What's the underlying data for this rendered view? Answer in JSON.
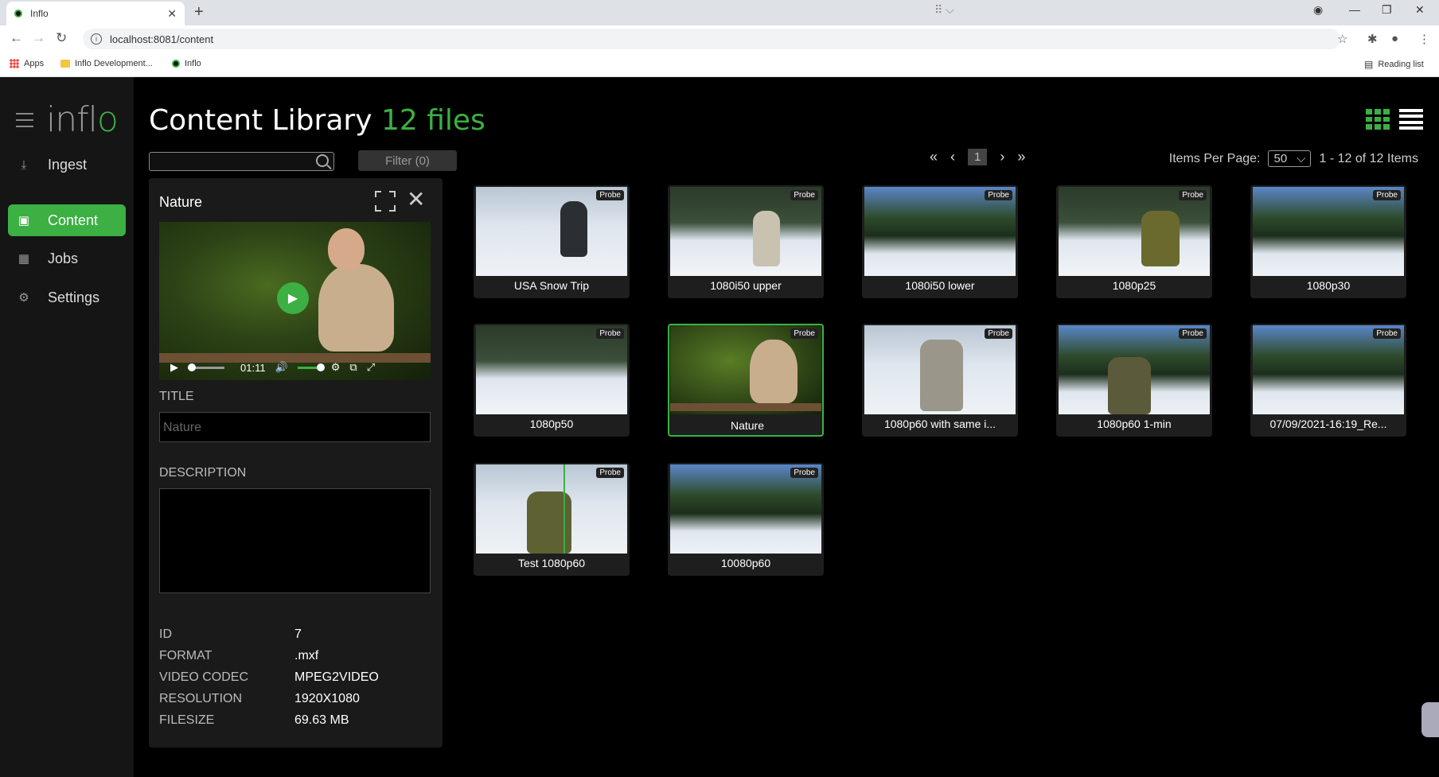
{
  "browser": {
    "tab_title": "Inflo",
    "url": "localhost:8081/content",
    "bookmarks": [
      "Apps",
      "Inflo Development...",
      "Inflo"
    ],
    "reading_list": "Reading list"
  },
  "sidebar": {
    "logo_prefix": "infl",
    "logo_suffix": "o",
    "items": [
      {
        "label": "Ingest",
        "icon": "download-icon"
      },
      {
        "label": "Content",
        "icon": "video-icon"
      },
      {
        "label": "Jobs",
        "icon": "board-icon"
      },
      {
        "label": "Settings",
        "icon": "gear-icon"
      }
    ]
  },
  "header": {
    "title": "Content Library",
    "count": "12 files"
  },
  "toolbar": {
    "search_placeholder": "",
    "filter_label": "Filter (0)",
    "page": "1",
    "items_per_page_label": "Items Per Page:",
    "items_per_page_value": "50",
    "range_text": "1 - 12 of 12 Items"
  },
  "detail": {
    "title": "Nature",
    "player_time": "01:11",
    "title_label": "TITLE",
    "title_value": "Nature",
    "description_label": "DESCRIPTION",
    "description_value": "",
    "meta": [
      {
        "key": "ID",
        "value": "7"
      },
      {
        "key": "FORMAT",
        "value": ".mxf"
      },
      {
        "key": "VIDEO CODEC",
        "value": "MPEG2VIDEO"
      },
      {
        "key": "RESOLUTION",
        "value": "1920X1080"
      },
      {
        "key": "FILESIZE",
        "value": "69.63 MB"
      }
    ]
  },
  "files": [
    {
      "label": "USA Snow Trip",
      "badge": "Probe"
    },
    {
      "label": "1080i50 upper",
      "badge": "Probe"
    },
    {
      "label": "1080i50 lower",
      "badge": "Probe"
    },
    {
      "label": "1080p25",
      "badge": "Probe"
    },
    {
      "label": "1080p30",
      "badge": "Probe"
    },
    {
      "label": "1080p50",
      "badge": "Probe"
    },
    {
      "label": "Nature",
      "badge": "Probe",
      "selected": true
    },
    {
      "label": "1080p60 with same i...",
      "badge": "Probe"
    },
    {
      "label": "1080p60 1-min",
      "badge": "Probe"
    },
    {
      "label": "07/09/2021-16:19_Re...",
      "badge": "Probe"
    },
    {
      "label": "Test 1080p60",
      "badge": "Probe"
    },
    {
      "label": "10080p60",
      "badge": "Probe"
    }
  ],
  "colors": {
    "accent": "#3cb043",
    "background": "#000000",
    "sidebar": "#151515",
    "panel": "#1a1a1a"
  }
}
